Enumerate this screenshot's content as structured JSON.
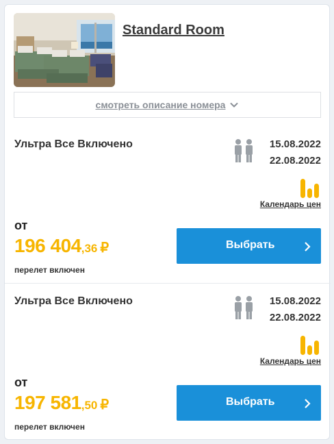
{
  "room": {
    "title": "Standard Room",
    "photo_alt": "hotel-room-photo",
    "description_toggle": "смотреть описание номера"
  },
  "offers": [
    {
      "meal": "Ультра Все Включено",
      "date_from": "15.08.2022",
      "date_to": "22.08.2022",
      "calendar_link": "Календарь цен",
      "price_prefix": "от",
      "price_main": "196 404",
      "price_cents": ",36",
      "currency": "₽",
      "flight_note": "перелет включен",
      "select_label": "Выбрать"
    },
    {
      "meal": "Ультра Все Включено",
      "date_from": "15.08.2022",
      "date_to": "22.08.2022",
      "calendar_link": "Календарь цен",
      "price_prefix": "от",
      "price_main": "197 581",
      "price_cents": ",50",
      "currency": "₽",
      "flight_note": "перелет включен",
      "select_label": "Выбрать"
    }
  ],
  "colors": {
    "accent_price": "#f7b500",
    "button": "#1a90d9",
    "icon_gray": "#9aa0a6"
  },
  "icons": {
    "persons": "two-persons-icon",
    "calendar": "price-calendar-bars-icon",
    "chevron": "chevron-down-icon",
    "arrow": "chevron-right-icon"
  }
}
